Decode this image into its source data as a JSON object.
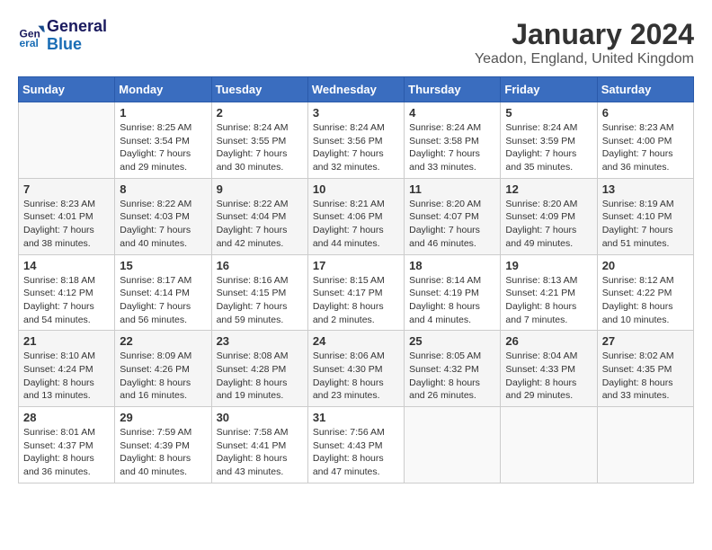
{
  "header": {
    "logo_line1": "General",
    "logo_line2": "Blue",
    "main_title": "January 2024",
    "subtitle": "Yeadon, England, United Kingdom"
  },
  "calendar": {
    "days_of_week": [
      "Sunday",
      "Monday",
      "Tuesday",
      "Wednesday",
      "Thursday",
      "Friday",
      "Saturday"
    ],
    "weeks": [
      [
        {
          "day": "",
          "info": ""
        },
        {
          "day": "1",
          "info": "Sunrise: 8:25 AM\nSunset: 3:54 PM\nDaylight: 7 hours\nand 29 minutes."
        },
        {
          "day": "2",
          "info": "Sunrise: 8:24 AM\nSunset: 3:55 PM\nDaylight: 7 hours\nand 30 minutes."
        },
        {
          "day": "3",
          "info": "Sunrise: 8:24 AM\nSunset: 3:56 PM\nDaylight: 7 hours\nand 32 minutes."
        },
        {
          "day": "4",
          "info": "Sunrise: 8:24 AM\nSunset: 3:58 PM\nDaylight: 7 hours\nand 33 minutes."
        },
        {
          "day": "5",
          "info": "Sunrise: 8:24 AM\nSunset: 3:59 PM\nDaylight: 7 hours\nand 35 minutes."
        },
        {
          "day": "6",
          "info": "Sunrise: 8:23 AM\nSunset: 4:00 PM\nDaylight: 7 hours\nand 36 minutes."
        }
      ],
      [
        {
          "day": "7",
          "info": "Sunrise: 8:23 AM\nSunset: 4:01 PM\nDaylight: 7 hours\nand 38 minutes."
        },
        {
          "day": "8",
          "info": "Sunrise: 8:22 AM\nSunset: 4:03 PM\nDaylight: 7 hours\nand 40 minutes."
        },
        {
          "day": "9",
          "info": "Sunrise: 8:22 AM\nSunset: 4:04 PM\nDaylight: 7 hours\nand 42 minutes."
        },
        {
          "day": "10",
          "info": "Sunrise: 8:21 AM\nSunset: 4:06 PM\nDaylight: 7 hours\nand 44 minutes."
        },
        {
          "day": "11",
          "info": "Sunrise: 8:20 AM\nSunset: 4:07 PM\nDaylight: 7 hours\nand 46 minutes."
        },
        {
          "day": "12",
          "info": "Sunrise: 8:20 AM\nSunset: 4:09 PM\nDaylight: 7 hours\nand 49 minutes."
        },
        {
          "day": "13",
          "info": "Sunrise: 8:19 AM\nSunset: 4:10 PM\nDaylight: 7 hours\nand 51 minutes."
        }
      ],
      [
        {
          "day": "14",
          "info": "Sunrise: 8:18 AM\nSunset: 4:12 PM\nDaylight: 7 hours\nand 54 minutes."
        },
        {
          "day": "15",
          "info": "Sunrise: 8:17 AM\nSunset: 4:14 PM\nDaylight: 7 hours\nand 56 minutes."
        },
        {
          "day": "16",
          "info": "Sunrise: 8:16 AM\nSunset: 4:15 PM\nDaylight: 7 hours\nand 59 minutes."
        },
        {
          "day": "17",
          "info": "Sunrise: 8:15 AM\nSunset: 4:17 PM\nDaylight: 8 hours\nand 2 minutes."
        },
        {
          "day": "18",
          "info": "Sunrise: 8:14 AM\nSunset: 4:19 PM\nDaylight: 8 hours\nand 4 minutes."
        },
        {
          "day": "19",
          "info": "Sunrise: 8:13 AM\nSunset: 4:21 PM\nDaylight: 8 hours\nand 7 minutes."
        },
        {
          "day": "20",
          "info": "Sunrise: 8:12 AM\nSunset: 4:22 PM\nDaylight: 8 hours\nand 10 minutes."
        }
      ],
      [
        {
          "day": "21",
          "info": "Sunrise: 8:10 AM\nSunset: 4:24 PM\nDaylight: 8 hours\nand 13 minutes."
        },
        {
          "day": "22",
          "info": "Sunrise: 8:09 AM\nSunset: 4:26 PM\nDaylight: 8 hours\nand 16 minutes."
        },
        {
          "day": "23",
          "info": "Sunrise: 8:08 AM\nSunset: 4:28 PM\nDaylight: 8 hours\nand 19 minutes."
        },
        {
          "day": "24",
          "info": "Sunrise: 8:06 AM\nSunset: 4:30 PM\nDaylight: 8 hours\nand 23 minutes."
        },
        {
          "day": "25",
          "info": "Sunrise: 8:05 AM\nSunset: 4:32 PM\nDaylight: 8 hours\nand 26 minutes."
        },
        {
          "day": "26",
          "info": "Sunrise: 8:04 AM\nSunset: 4:33 PM\nDaylight: 8 hours\nand 29 minutes."
        },
        {
          "day": "27",
          "info": "Sunrise: 8:02 AM\nSunset: 4:35 PM\nDaylight: 8 hours\nand 33 minutes."
        }
      ],
      [
        {
          "day": "28",
          "info": "Sunrise: 8:01 AM\nSunset: 4:37 PM\nDaylight: 8 hours\nand 36 minutes."
        },
        {
          "day": "29",
          "info": "Sunrise: 7:59 AM\nSunset: 4:39 PM\nDaylight: 8 hours\nand 40 minutes."
        },
        {
          "day": "30",
          "info": "Sunrise: 7:58 AM\nSunset: 4:41 PM\nDaylight: 8 hours\nand 43 minutes."
        },
        {
          "day": "31",
          "info": "Sunrise: 7:56 AM\nSunset: 4:43 PM\nDaylight: 8 hours\nand 47 minutes."
        },
        {
          "day": "",
          "info": ""
        },
        {
          "day": "",
          "info": ""
        },
        {
          "day": "",
          "info": ""
        }
      ]
    ]
  }
}
